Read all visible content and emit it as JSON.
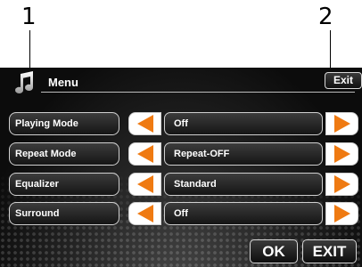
{
  "callouts": [
    "1",
    "2"
  ],
  "header": {
    "title": "Menu",
    "exit_label": "Exit",
    "icon": "music-note-icon"
  },
  "settings": [
    {
      "label": "Playing Mode",
      "value": "Off"
    },
    {
      "label": "Repeat Mode",
      "value": "Repeat-OFF"
    },
    {
      "label": "Equalizer",
      "value": "Standard"
    },
    {
      "label": "Surround",
      "value": "Off"
    }
  ],
  "footer": {
    "ok_label": "OK",
    "exit_label": "EXIT"
  },
  "colors": {
    "accent": "#ef7a12",
    "screen_bg": "#151515",
    "text": "#ffffff"
  }
}
